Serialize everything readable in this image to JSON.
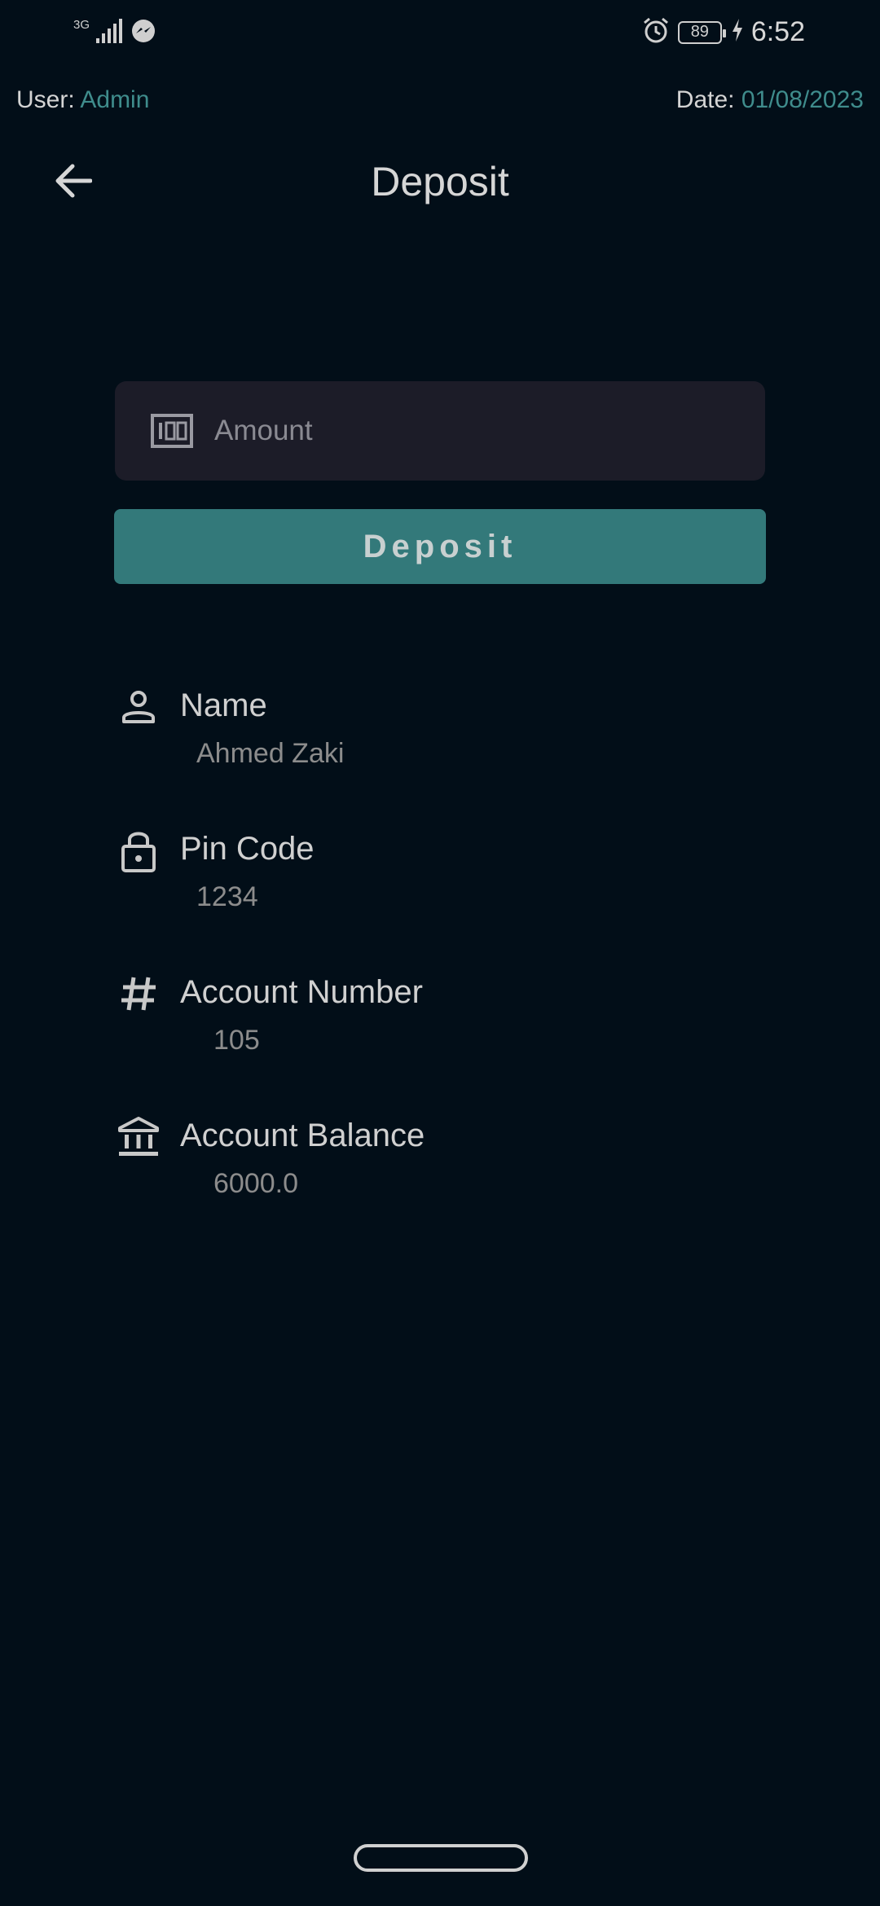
{
  "status_bar": {
    "network_type": "3G",
    "battery_level": "89",
    "time": "6:52"
  },
  "info": {
    "user_label": "User:",
    "user_value": "Admin",
    "date_label": "Date:",
    "date_value": "01/08/2023"
  },
  "header": {
    "title": "Deposit"
  },
  "form": {
    "amount_placeholder": "Amount",
    "amount_value": "",
    "deposit_button_label": "Deposit"
  },
  "details": {
    "name": {
      "label": "Name",
      "value": "Ahmed Zaki"
    },
    "pin_code": {
      "label": "Pin Code",
      "value": "1234"
    },
    "account_number": {
      "label": "Account Number",
      "value": "105"
    },
    "account_balance": {
      "label": "Account Balance",
      "value": "6000.0"
    }
  },
  "icons": {
    "back": "arrow-back-icon",
    "amount": "money-icon",
    "name": "person-icon",
    "pin": "lock-icon",
    "account_number": "hash-icon",
    "balance": "bank-icon"
  },
  "colors": {
    "background": "#020e18",
    "accent": "#3f8c8c",
    "button": "#33797a",
    "field": "#1c1c28"
  }
}
